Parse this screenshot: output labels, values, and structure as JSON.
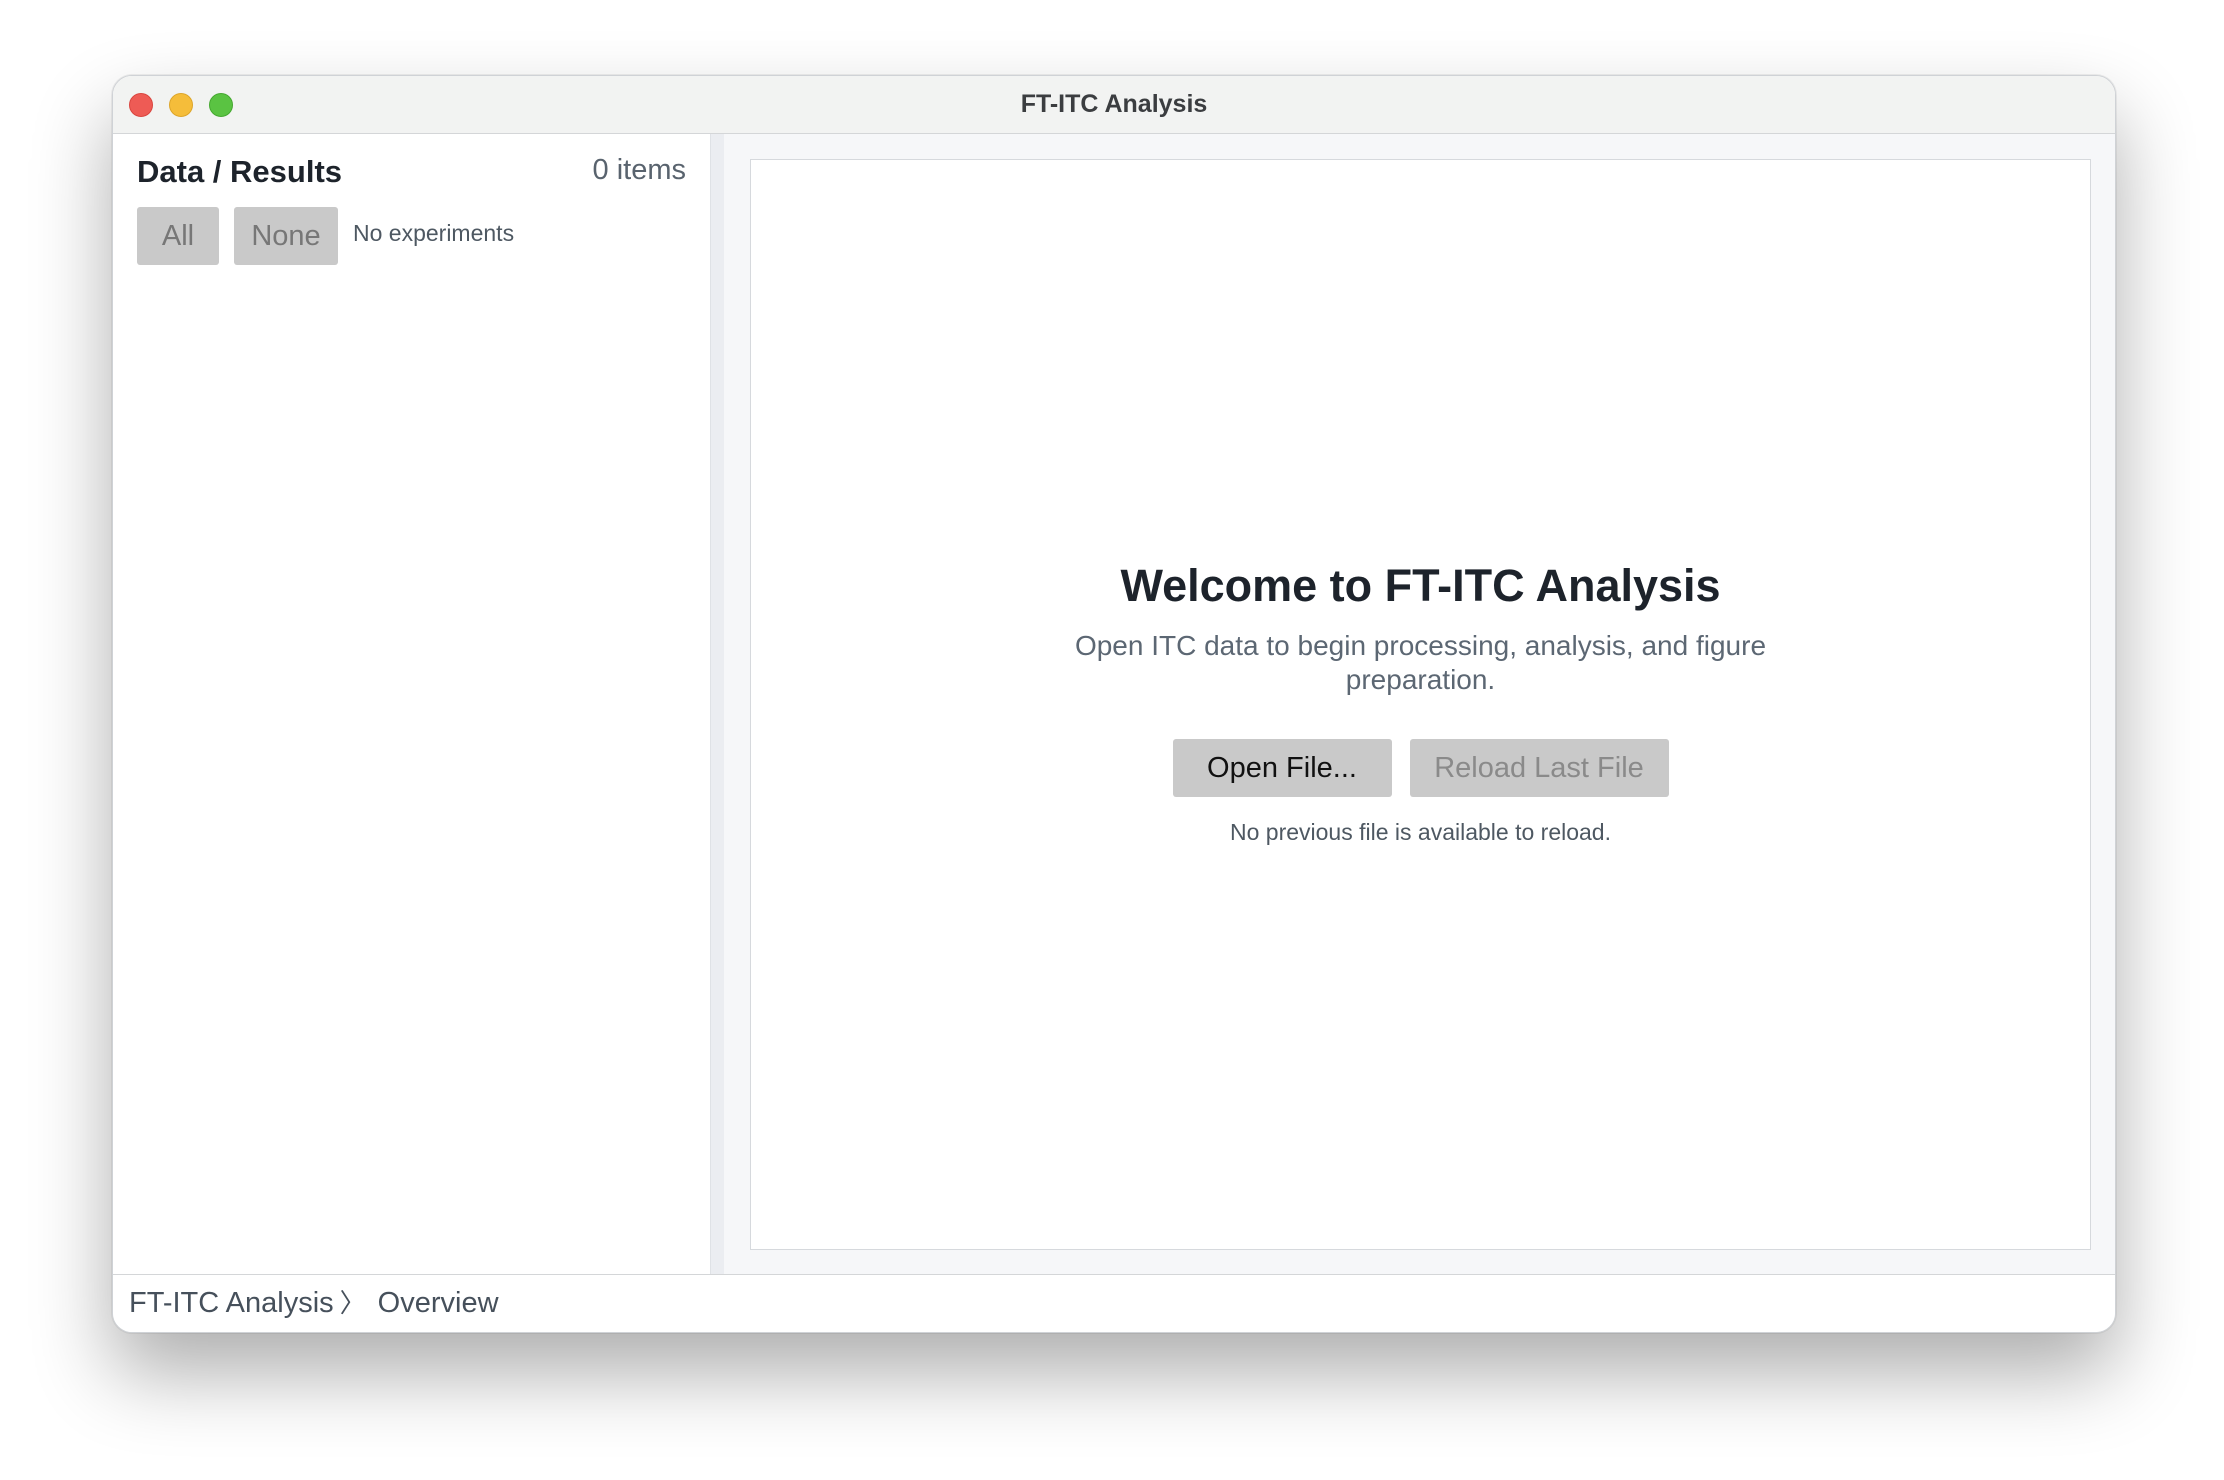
{
  "window": {
    "title": "FT-ITC Analysis"
  },
  "sidebar": {
    "title": "Data / Results",
    "count": "0 items",
    "all_label": "All",
    "none_label": "None",
    "empty_text": "No experiments"
  },
  "welcome": {
    "title": "Welcome to FT-ITC Analysis",
    "subtitle": "Open ITC data to begin processing, analysis, and figure preparation.",
    "open_label": "Open File...",
    "reload_label": "Reload Last File",
    "note": "No previous file is available to reload."
  },
  "breadcrumb": {
    "items": [
      "FT-ITC Analysis",
      "Overview"
    ],
    "separator": "〉"
  },
  "colors": {
    "close": "#ee5b55",
    "minimize": "#f5bd3a",
    "maximize": "#5ac342",
    "button_bg": "#c9c9c9"
  }
}
